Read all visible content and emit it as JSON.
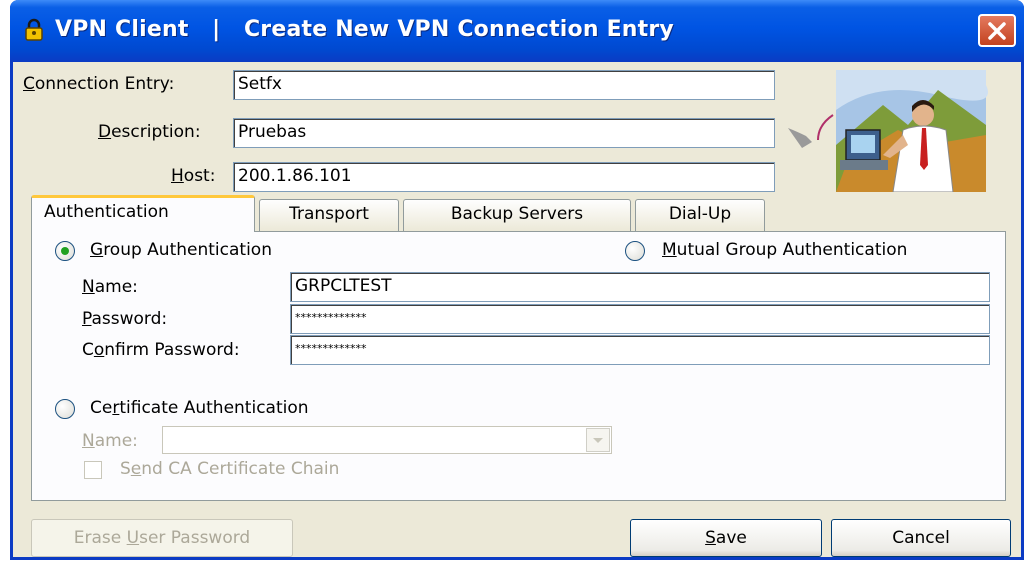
{
  "window": {
    "title": "VPN Client   |   Create New VPN Connection Entry",
    "title_icon": "padlock-icon",
    "close_icon": "close-icon"
  },
  "form": {
    "connection_entry": {
      "label_prefix": "",
      "label_u": "C",
      "label_rest": "onnection Entry:",
      "value": "Setfx"
    },
    "description": {
      "label_prefix": "",
      "label_u": "D",
      "label_rest": "escription:",
      "value": "Pruebas"
    },
    "host": {
      "label_prefix": "",
      "label_u": "H",
      "label_rest": "ost:",
      "value": "200.1.86.101"
    }
  },
  "tabs": [
    {
      "label": "Authentication",
      "active": true
    },
    {
      "label": "Transport",
      "active": false
    },
    {
      "label": "Backup Servers",
      "active": false
    },
    {
      "label": "Dial-Up",
      "active": false
    }
  ],
  "auth": {
    "group_auth": {
      "u": "G",
      "rest": "roup Authentication",
      "selected": true
    },
    "mutual_auth": {
      "u": "M",
      "rest": "utual Group Authentication",
      "selected": false
    },
    "name": {
      "u": "N",
      "rest": "ame:",
      "value": "GRPCLTEST"
    },
    "password": {
      "u": "P",
      "rest": "assword:",
      "value": "*************"
    },
    "confirm_password": {
      "pre": "C",
      "u": "o",
      "rest": "nfirm Password:",
      "value": "*************"
    },
    "cert_auth": {
      "pre": "Ce",
      "u": "r",
      "rest": "tificate Authentication",
      "selected": false
    },
    "cert_name": {
      "u": "N",
      "rest": "ame:",
      "value": ""
    },
    "send_ca": {
      "pre": "S",
      "u": "e",
      "rest": "nd CA Certificate Chain",
      "checked": false
    }
  },
  "buttons": {
    "erase": {
      "pre": "Erase ",
      "u": "U",
      "rest": "ser Password",
      "enabled": false
    },
    "save": {
      "pre": "",
      "u": "S",
      "rest": "ave"
    },
    "cancel": {
      "label": "Cancel"
    }
  },
  "colors": {
    "titlebar": "#0054e3",
    "dialog_bg": "#ece9d8",
    "active_tab_accent": "#ffc83c",
    "radio_dot": "#21a121"
  }
}
